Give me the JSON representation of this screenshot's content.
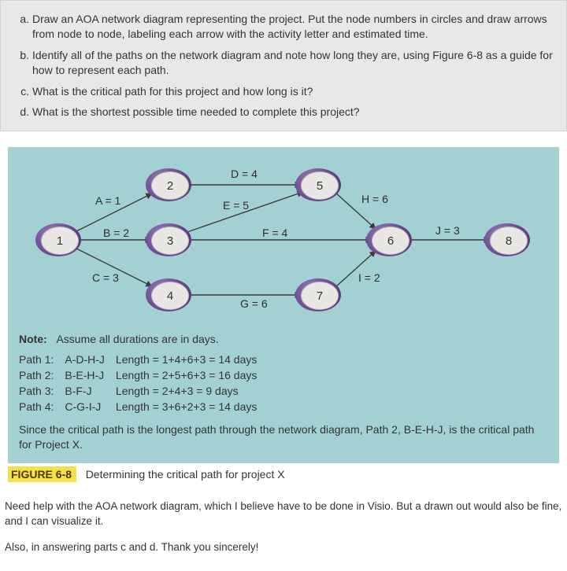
{
  "questions": {
    "a": "Draw an AOA network diagram representing the project. Put the node numbers in circles and draw arrows from node to node, labeling each arrow with the activity letter and estimated time.",
    "b": "Identify all of the paths on the network diagram and note how long they are, using Figure 6-8 as a guide for how to represent each path.",
    "c": "What is the critical path for this project and how long is it?",
    "d": "What is the shortest possible time needed to complete this project?"
  },
  "diagram": {
    "nodes": {
      "n1": "1",
      "n2": "2",
      "n3": "3",
      "n4": "4",
      "n5": "5",
      "n6": "6",
      "n7": "7",
      "n8": "8"
    },
    "edges": {
      "A": "A = 1",
      "B": "B = 2",
      "C": "C = 3",
      "D": "D = 4",
      "E": "E = 5",
      "F": "F = 4",
      "G": "G = 6",
      "H": "H = 6",
      "I": "I = 2",
      "J": "J = 3"
    }
  },
  "note_prefix": "Note:",
  "note_text": "Assume all durations are in days.",
  "paths": [
    {
      "label": "Path 1:",
      "name": "A-D-H-J",
      "length": "Length = 1+4+6+3 = 14 days"
    },
    {
      "label": "Path 2:",
      "name": "B-E-H-J",
      "length": "Length = 2+5+6+3 = 16 days"
    },
    {
      "label": "Path 3:",
      "name": "B-F-J",
      "length": "Length = 2+4+3 = 9 days"
    },
    {
      "label": "Path 4:",
      "name": "C-G-I-J",
      "length": "Length = 3+6+2+3 = 14 days"
    }
  ],
  "conclusion": "Since the critical path is the longest path through the network diagram, Path 2, B-E-H-J, is the critical path for Project X.",
  "figure_caption": {
    "tag": "FIGURE 6-8",
    "text": "Determining the critical path for project X"
  },
  "user_text": {
    "p1": "Need help with the AOA network diagram, which I believe have to be done in Visio. But a drawn out would also be fine, and I can visualize it.",
    "p2": "Also, in answering parts c and d. Thank you sincerely!"
  },
  "chart_data": {
    "type": "network",
    "nodes": [
      1,
      2,
      3,
      4,
      5,
      6,
      7,
      8
    ],
    "edges": [
      {
        "id": "A",
        "from": 1,
        "to": 2,
        "duration": 1
      },
      {
        "id": "B",
        "from": 1,
        "to": 3,
        "duration": 2
      },
      {
        "id": "C",
        "from": 1,
        "to": 4,
        "duration": 3
      },
      {
        "id": "D",
        "from": 2,
        "to": 5,
        "duration": 4
      },
      {
        "id": "E",
        "from": 3,
        "to": 5,
        "duration": 5
      },
      {
        "id": "F",
        "from": 3,
        "to": 6,
        "duration": 4
      },
      {
        "id": "G",
        "from": 4,
        "to": 7,
        "duration": 6
      },
      {
        "id": "H",
        "from": 5,
        "to": 6,
        "duration": 6
      },
      {
        "id": "I",
        "from": 7,
        "to": 6,
        "duration": 2
      },
      {
        "id": "J",
        "from": 6,
        "to": 8,
        "duration": 3
      }
    ],
    "paths": [
      {
        "name": "A-D-H-J",
        "length_days": 14
      },
      {
        "name": "B-E-H-J",
        "length_days": 16
      },
      {
        "name": "B-F-J",
        "length_days": 9
      },
      {
        "name": "C-G-I-J",
        "length_days": 14
      }
    ],
    "critical_path": "B-E-H-J",
    "critical_path_length_days": 16
  }
}
